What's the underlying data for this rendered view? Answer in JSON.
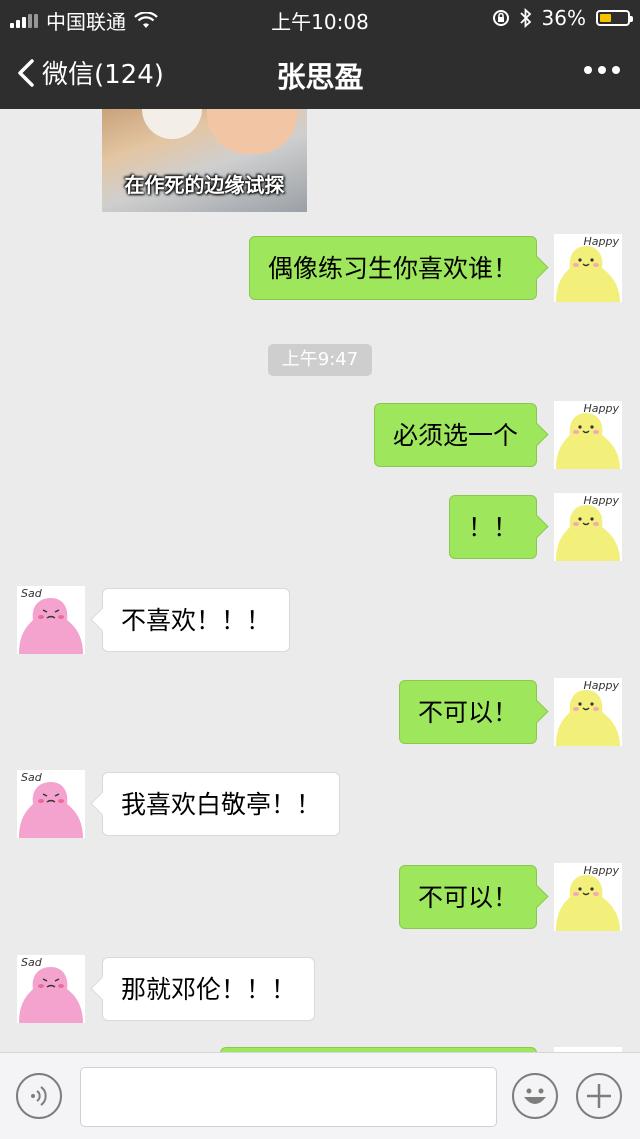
{
  "status_bar": {
    "carrier": "中国联通",
    "time": "上午10:08",
    "battery": "36%",
    "battery_level": 0.36
  },
  "nav": {
    "back_label": "微信(124)",
    "title": "张思盈"
  },
  "chat": {
    "image_caption": "在作死的边缘试探",
    "timestamp": "上午9:47",
    "messages": [
      {
        "from": "me",
        "text": "偶像练习生你喜欢谁！"
      },
      {
        "from": "me",
        "text": "必须选一个"
      },
      {
        "from": "me",
        "text": "！！"
      },
      {
        "from": "them",
        "text": "不喜欢！！！"
      },
      {
        "from": "me",
        "text": "不可以！"
      },
      {
        "from": "them",
        "text": "我喜欢白敬亭！！"
      },
      {
        "from": "me",
        "text": "不可以！"
      },
      {
        "from": "them",
        "text": "那就邓伦！！！"
      }
    ],
    "my_avatar_label": "Happy",
    "their_avatar_label": "Sad"
  },
  "colors": {
    "my_bubble": "#9ee65c",
    "their_bubble": "#ffffff",
    "nav_bg": "#2e2e2e",
    "chat_bg": "#ebebeb"
  }
}
